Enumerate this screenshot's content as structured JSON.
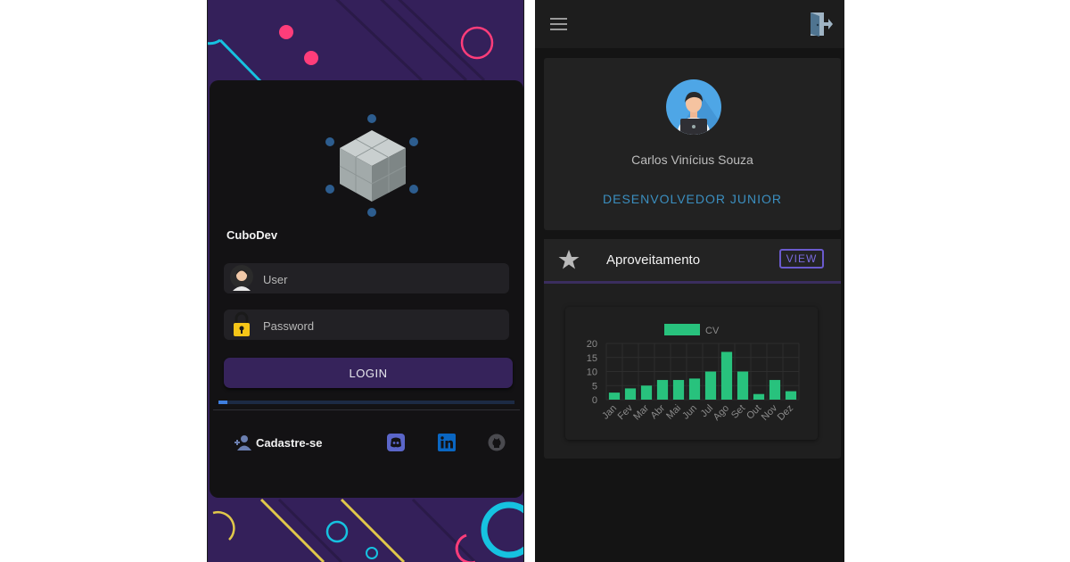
{
  "login": {
    "app_name": "CuboDev",
    "user_placeholder": "User",
    "password_placeholder": "Password",
    "login_label": "LOGIN",
    "progress_fraction": 0.03,
    "signup_label": "Cadastre-se",
    "social_icons": [
      "discord-icon",
      "linkedin-icon",
      "github-icon"
    ]
  },
  "dashboard": {
    "profile": {
      "name": "Carlos Vinícius Souza",
      "role": "DESENVOLVEDOR JUNIOR"
    },
    "performance": {
      "title": "Aproveitamento",
      "view_label": "VIEW"
    }
  },
  "colors": {
    "accent_purple": "#34205a",
    "role_blue": "#3b8fc0",
    "bar_green": "#28c27d",
    "view_border": "#6a5acd"
  },
  "chart_data": {
    "type": "bar",
    "categories": [
      "Jan",
      "Fev",
      "Mar",
      "Abr",
      "Mai",
      "Jun",
      "Jul",
      "Ago",
      "Set",
      "Out",
      "Nov",
      "Dez"
    ],
    "series": [
      {
        "name": "CV",
        "values": [
          2.5,
          4,
          5,
          7,
          7,
          7.5,
          10,
          17,
          10,
          2,
          7,
          3
        ]
      }
    ],
    "ylim": [
      0,
      20
    ],
    "yticks": [
      0,
      5,
      10,
      15,
      20
    ],
    "grid": true,
    "legend": "top-center"
  }
}
